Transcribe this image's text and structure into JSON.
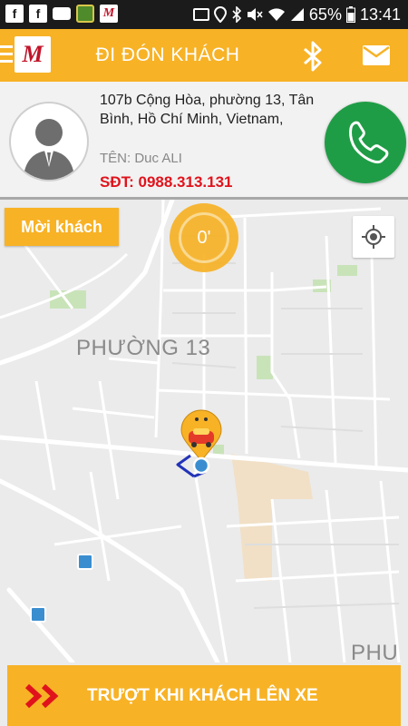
{
  "status_bar": {
    "battery": "65%",
    "time": "13:41"
  },
  "header": {
    "title": "ĐI ĐÓN KHÁCH",
    "logo_text": "M"
  },
  "customer": {
    "address": "107b Cộng Hòa, phường 13, Tân Bình, Hồ Chí Minh, Vietnam,",
    "name": "TÊN: Duc ALI",
    "phone": "SĐT: 0988.313.131"
  },
  "map": {
    "invite_button": "Mời khách",
    "timer": "0'",
    "labels": {
      "ward": "PHƯỜNG 13",
      "ward_edge": "PHU"
    }
  },
  "slide_action": {
    "label": "TRƯỢT KHI KHÁCH LÊN XE"
  },
  "colors": {
    "accent": "#f7b226",
    "call": "#1f9d46",
    "phone_text": "#e0131c",
    "location_dot": "#3a8ed0"
  },
  "icons": [
    "menu-icon",
    "bluetooth-icon",
    "mail-icon",
    "phone-icon",
    "user-avatar-icon",
    "my-location-icon",
    "double-arrow-icon",
    "taxi-marker-icon"
  ]
}
